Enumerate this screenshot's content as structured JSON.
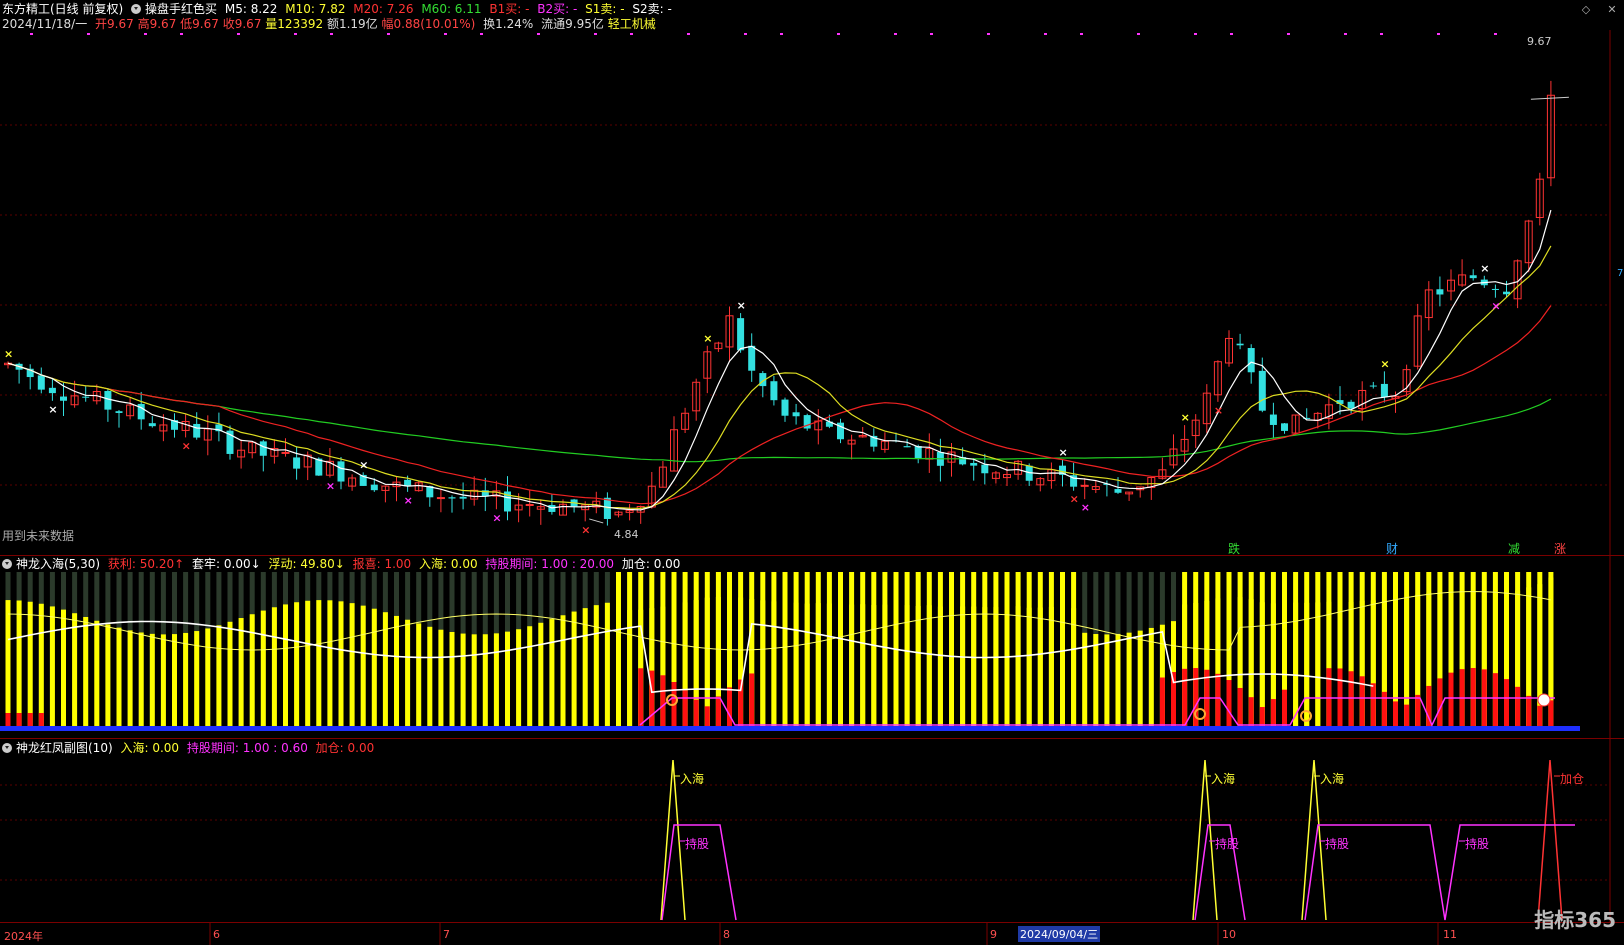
{
  "header": {
    "title": "东方精工(日线 前复权)",
    "indicator": "操盘手红色买",
    "ma": [
      {
        "label": "M5: 8.22",
        "color": "#ffffff"
      },
      {
        "label": "M10: 7.82",
        "color": "#ffff33"
      },
      {
        "label": "M20: 7.26",
        "color": "#ff3333"
      },
      {
        "label": "M60: 6.11",
        "color": "#33dd33"
      },
      {
        "label": "B1买: -",
        "color": "#ff3333"
      },
      {
        "label": "B2买: -",
        "color": "#ff33ff"
      },
      {
        "label": "S1卖: -",
        "color": "#ffff33"
      },
      {
        "label": "S2卖: -",
        "color": "#ffffff"
      }
    ],
    "ohlc": [
      {
        "label": "2024/11/18/一",
        "color": "#dddddd"
      },
      {
        "label": "开9.67",
        "color": "#ff4444"
      },
      {
        "label": "高9.67",
        "color": "#ff4444"
      },
      {
        "label": "低9.67",
        "color": "#ff4444"
      },
      {
        "label": "收9.67",
        "color": "#ff4444"
      },
      {
        "label": "量123392",
        "color": "#ffff33"
      },
      {
        "label": "额1.19亿",
        "color": "#dddddd"
      },
      {
        "label": "幅0.88(10.01%)",
        "color": "#ff4444"
      },
      {
        "label": "换1.24%",
        "color": "#dddddd"
      },
      {
        "label": "流通9.95亿",
        "color": "#dddddd"
      },
      {
        "label": "轻工机械",
        "color": "#ffff33"
      }
    ]
  },
  "main_chart": {
    "future_note": "用到未来数据",
    "high_label": "9.67",
    "low_label": "4.84",
    "events": [
      {
        "text": "跌",
        "color": "#33dd33"
      },
      {
        "text": "财",
        "color": "#33aaff"
      },
      {
        "text": "减",
        "color": "#33dd33"
      },
      {
        "text": "涨",
        "color": "#ff4444"
      }
    ],
    "side_marker": "7"
  },
  "panel2": {
    "title": "神龙入海(5,30)",
    "items": [
      {
        "label": "获利: 50.20↑",
        "color": "#ff3333"
      },
      {
        "label": "套牢: 0.00↓",
        "color": "#ffffff"
      },
      {
        "label": "浮动: 49.80↓",
        "color": "#ffff33"
      },
      {
        "label": "报喜: 1.00",
        "color": "#ff3333"
      },
      {
        "label": "入海: 0.00",
        "color": "#ffff33"
      },
      {
        "label": "持股期间: 1.00 : 20.00",
        "color": "#ff33ff"
      },
      {
        "label": "加仓: 0.00",
        "color": "#ffffff"
      }
    ]
  },
  "panel3": {
    "title": "神龙红凤副图(10)",
    "items": [
      {
        "label": "入海: 0.00",
        "color": "#ffff33"
      },
      {
        "label": "持股期间: 1.00 : 0.60",
        "color": "#ff33ff"
      },
      {
        "label": "加仓: 0.00",
        "color": "#ff3333"
      }
    ],
    "annotations": {
      "ruhai": "入海",
      "chigu": "持股",
      "jiacang": "加仓"
    }
  },
  "xaxis": {
    "labels": [
      "2024年",
      "6",
      "7",
      "8",
      "9",
      "10",
      "11"
    ],
    "cursor": "2024/09/04/三"
  },
  "logo": "指标365",
  "chart_data": {
    "type": "candlestick",
    "title": "东方精工(日线 前复权)",
    "y_unit": "price",
    "last": {
      "date": "2024/11/18",
      "open": 9.67,
      "high": 9.67,
      "low": 9.67,
      "close": 9.67
    },
    "ma_last": {
      "M5": 8.22,
      "M10": 7.82,
      "M20": 7.26,
      "M60": 6.11
    },
    "marked_high": 9.67,
    "marked_low": 4.84,
    "ylim": [
      4.6,
      10.3
    ]
  }
}
